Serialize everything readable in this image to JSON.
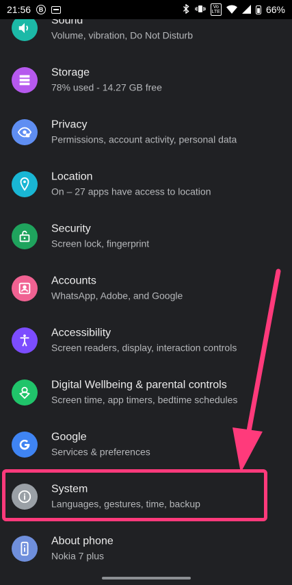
{
  "status_bar": {
    "time": "21:56",
    "battery_percent": "66%",
    "volte_label": "Vo\nLTE"
  },
  "settings": {
    "items": [
      {
        "title": "Sound",
        "summary": "Volume, vibration, Do Not Disturb",
        "icon": "speaker-icon",
        "color": "#1cb9a7"
      },
      {
        "title": "Storage",
        "summary": "78% used - 14.27 GB free",
        "icon": "storage-icon",
        "color": "#b659ee"
      },
      {
        "title": "Privacy",
        "summary": "Permissions, account activity, personal data",
        "icon": "privacy-eye-icon",
        "color": "#5f8ef2"
      },
      {
        "title": "Location",
        "summary": "On – 27 apps have access to location",
        "icon": "location-pin-icon",
        "color": "#19b6d4"
      },
      {
        "title": "Security",
        "summary": "Screen lock, fingerprint",
        "icon": "padlock-icon",
        "color": "#1fa35d"
      },
      {
        "title": "Accounts",
        "summary": "WhatsApp, Adobe, and Google",
        "icon": "account-icon",
        "color": "#f06292"
      },
      {
        "title": "Accessibility",
        "summary": "Screen readers, display, interaction controls",
        "icon": "accessibility-icon",
        "color": "#7c4dff"
      },
      {
        "title": "Digital Wellbeing & parental controls",
        "summary": "Screen time, app timers, bedtime schedules",
        "icon": "wellbeing-icon",
        "color": "#20c46a"
      },
      {
        "title": "Google",
        "summary": "Services & preferences",
        "icon": "google-icon",
        "color": "#3f84f3"
      },
      {
        "title": "System",
        "summary": "Languages, gestures, time, backup",
        "icon": "info-icon",
        "color": "#9aa0a6"
      },
      {
        "title": "About phone",
        "summary": "Nokia 7 plus",
        "icon": "phone-icon",
        "color": "#6f8fdc"
      }
    ]
  },
  "annotation": {
    "arrow_color": "#ff3a7b"
  }
}
